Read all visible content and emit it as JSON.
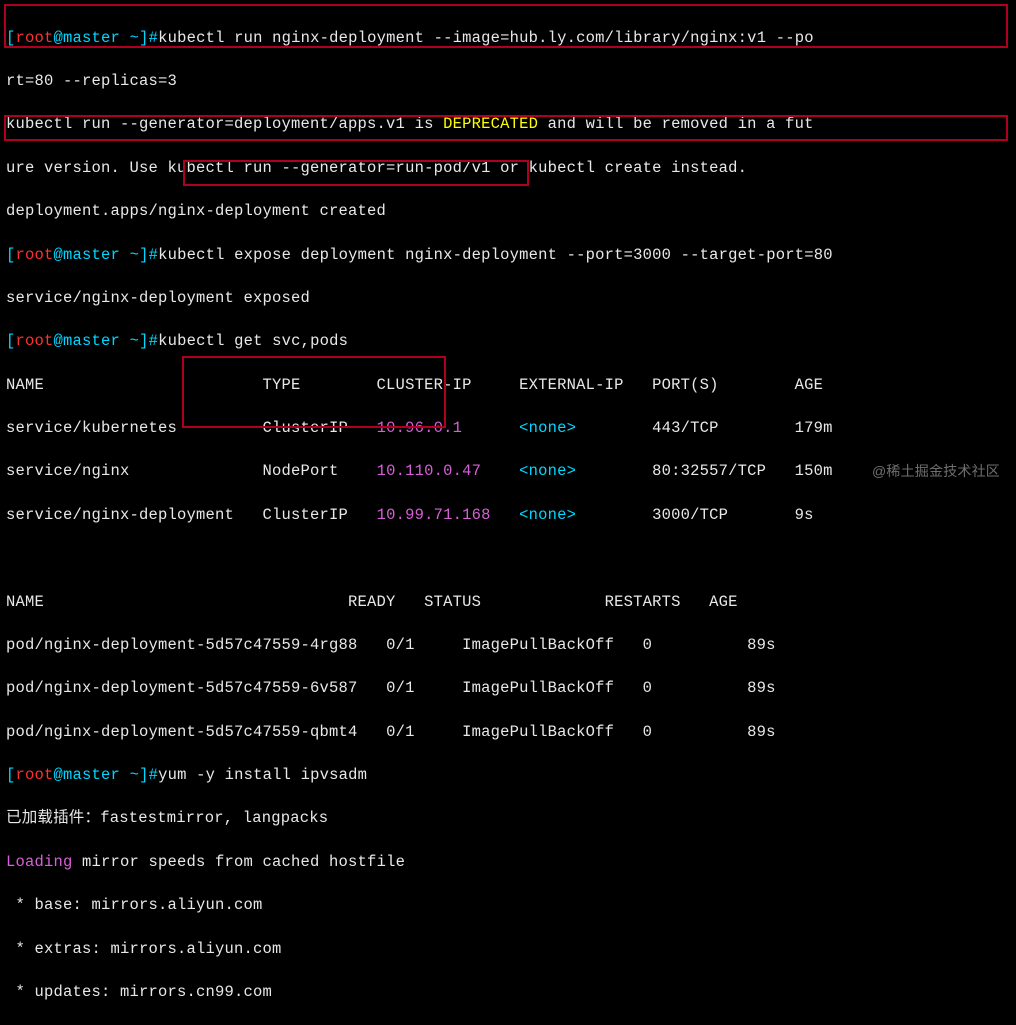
{
  "prompt": {
    "user": "root",
    "at": "@",
    "host": "master",
    "dir": " ~",
    "close": "]#"
  },
  "line1_cmd": "kubectl run nginx-deployment --image=hub.ly.com/library/nginx:v1 --po",
  "line1_wrap": "rt=80 --replicas=3",
  "dep_pre1": "kubectl run --generator=deployment/apps.v1 is ",
  "dep_word": "DEPRECATED",
  "dep_post1": " and will be removed in a fut",
  "dep_line2": "ure version. Use kubectl run --generator=run-pod/v1 or kubectl create instead.",
  "dep_line3": "deployment.apps/nginx-deployment created",
  "line2_cmd": "kubectl expose deployment nginx-deployment --port=3000 --target-port=80",
  "line2_out": "service/nginx-deployment exposed",
  "line3_cmd": "kubectl get svc,pods",
  "svc_header": "NAME                       TYPE        CLUSTER-IP     EXTERNAL-IP   PORT(S)        AGE",
  "svc_rows": [
    {
      "name": "service/kubernetes         ",
      "type": "ClusterIP   ",
      "ip": "10.96.0.1      ",
      "ext": "<none>",
      "ports": "        443/TCP        ",
      "age": "179m"
    },
    {
      "name": "service/nginx              ",
      "type": "NodePort    ",
      "ip": "10.110.0.47    ",
      "ext": "<none>",
      "ports": "        80:32557/TCP   ",
      "age": "150m"
    },
    {
      "name": "service/nginx-deployment   ",
      "type": "ClusterIP   ",
      "ip": "10.99.71.168   ",
      "ext": "<none>",
      "ports": "        3000/TCP       ",
      "age": "9s"
    }
  ],
  "pod_header": "NAME                                READY   STATUS             RESTARTS   AGE",
  "pod_rows": [
    {
      "name": "pod/nginx-deployment-5d57c47559-4rg88   ",
      "ready": "0/1     ",
      "status": "ImagePullBackOff   ",
      "restarts": "0          ",
      "age": "89s"
    },
    {
      "name": "pod/nginx-deployment-5d57c47559-6v587   ",
      "ready": "0/1     ",
      "status": "ImagePullBackOff   ",
      "restarts": "0          ",
      "age": "89s"
    },
    {
      "name": "pod/nginx-deployment-5d57c47559-qbmt4   ",
      "ready": "0/1     ",
      "status": "ImagePullBackOff   ",
      "restarts": "0          ",
      "age": "89s"
    }
  ],
  "line4_cmd": "yum -y install ipvsadm",
  "yum1": "已加载插件：fastestmirror, langpacks",
  "yum2_pre": "Loading",
  "yum2_rest": " mirror speeds from cached hostfile",
  "mirrors": [
    " * base: mirrors.aliyun.com",
    " * extras: mirrors.aliyun.com",
    " * updates: mirrors.cn99.com"
  ],
  "watermark": "@稀土掘金技术社区"
}
